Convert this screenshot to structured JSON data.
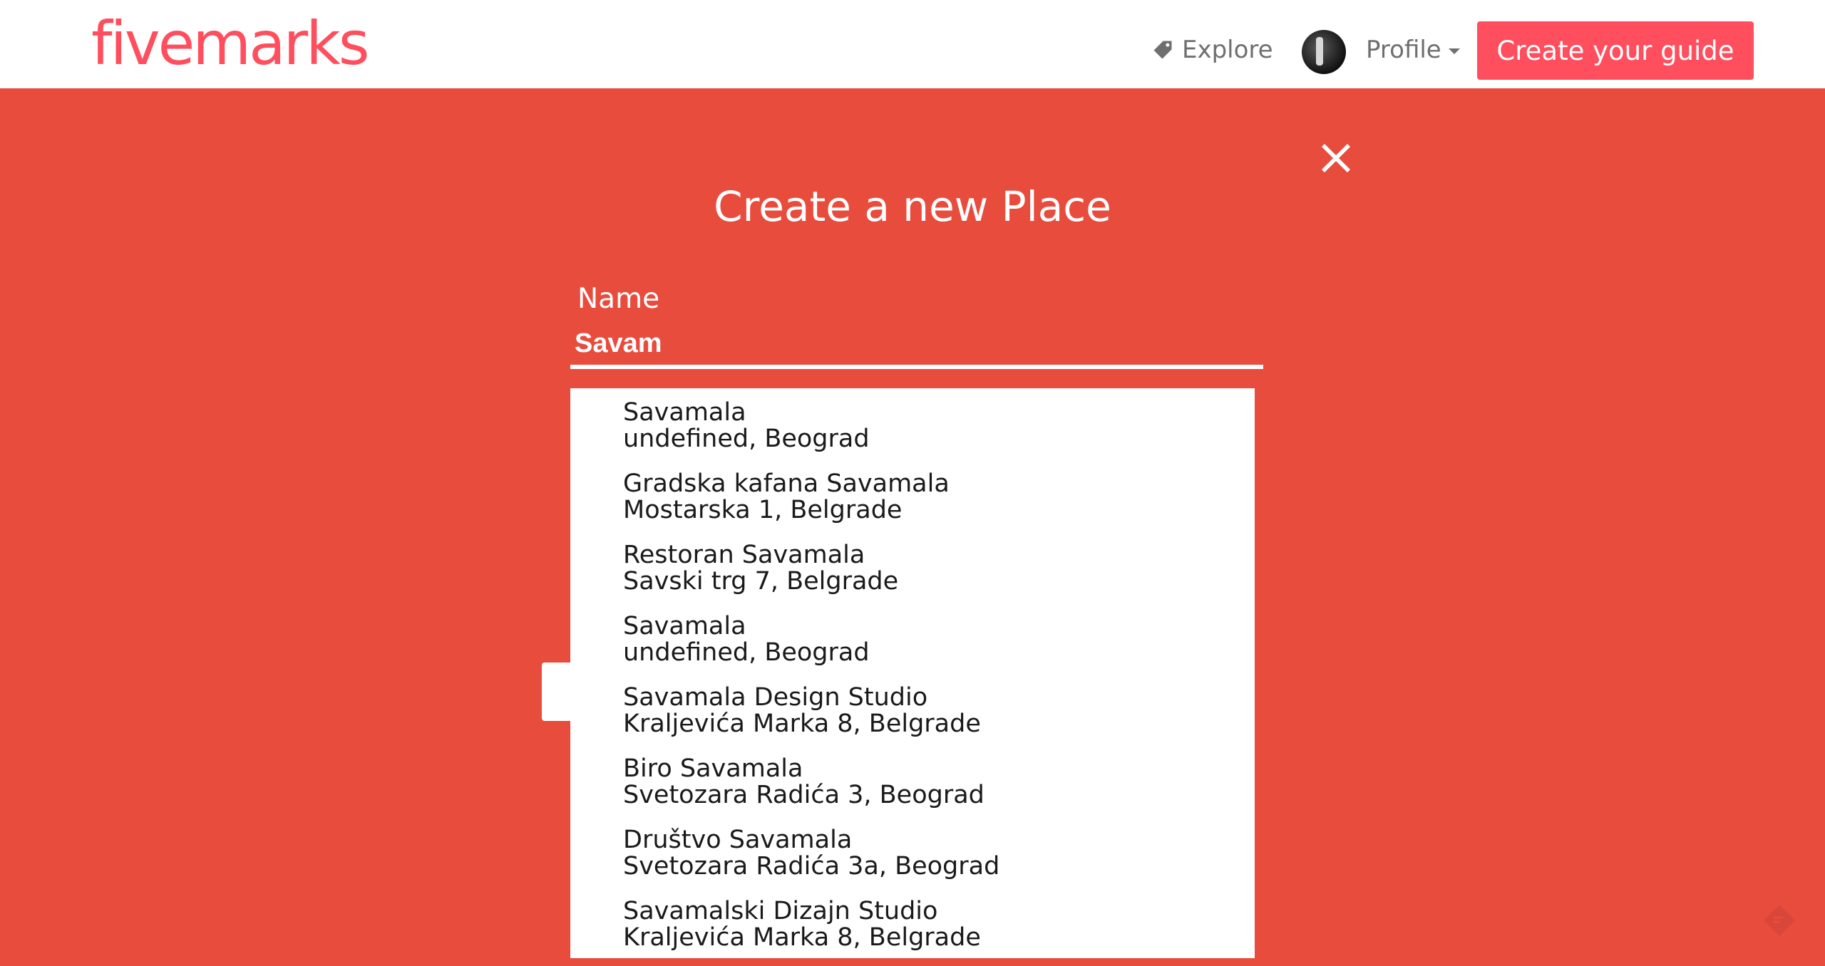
{
  "header": {
    "logo": "fivemarks",
    "nav_explore": "Explore",
    "nav_profile": "Profile",
    "create_guide": "Create your guide"
  },
  "modal": {
    "title": "Create a new Place",
    "name_label": "Name",
    "name_value": "Savam"
  },
  "suggestions": [
    {
      "name": "Savamala",
      "address": "undefined, Beograd"
    },
    {
      "name": "Gradska kafana Savamala",
      "address": "Mostarska 1, Belgrade"
    },
    {
      "name": "Restoran Savamala",
      "address": "Savski trg 7, Belgrade"
    },
    {
      "name": "Savamala",
      "address": "undefined, Beograd"
    },
    {
      "name": "Savamala Design Studio",
      "address": "Kraljevića Marka 8, Belgrade"
    },
    {
      "name": "Biro Savamala",
      "address": "Svetozara Radića 3, Beograd"
    },
    {
      "name": "Društvo Savamala",
      "address": "Svetozara Radića 3a, Beograd"
    },
    {
      "name": "Savamalski Dizajn Studio",
      "address": "Kraljevića Marka 8, Belgrade"
    }
  ],
  "colors": {
    "brand": "#ff4f5e",
    "background": "#e84c3d",
    "nav_text": "#6f6f6f"
  },
  "icons": {
    "explore": "tag-icon",
    "close": "close-icon",
    "feedback": "feedback-icon"
  }
}
